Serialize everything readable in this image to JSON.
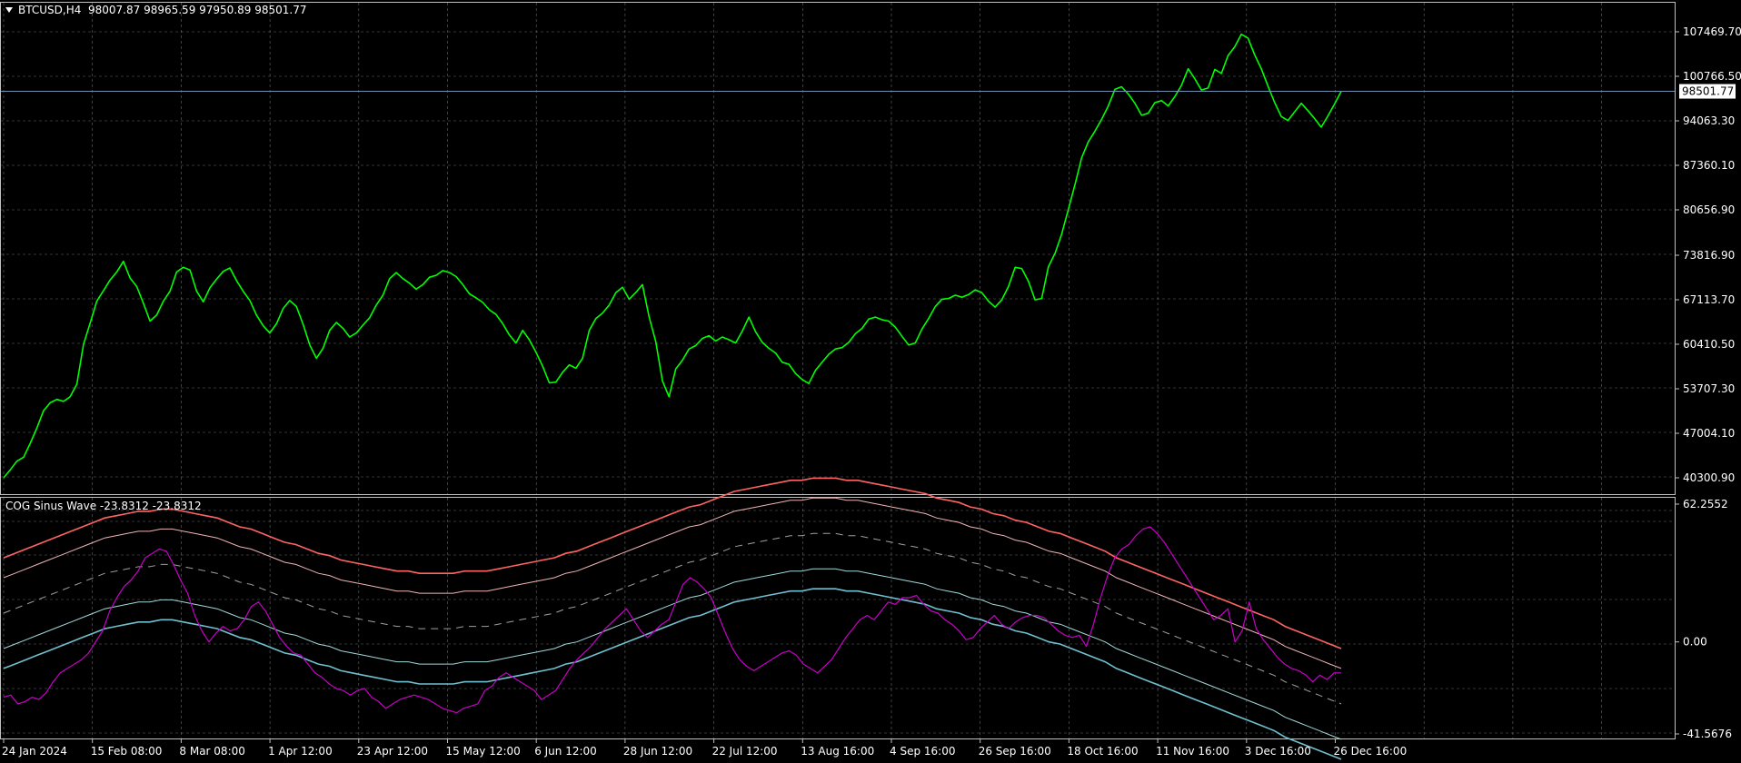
{
  "header": {
    "symbol": "BTCUSD,H4",
    "ohlc": "98007.87 98965.59 97950.89 98501.77"
  },
  "indicator": {
    "title": "COG Sinus Wave -23.8312 -23.8312"
  },
  "colors": {
    "background": "#000000",
    "grid": "#c0c0c0",
    "price": "#00ff00",
    "indicator_line": "#c800c8",
    "band_upper": "#ff6464",
    "band_upper_inner": "#f0b4b4",
    "band_mid": "#a0a0a0",
    "band_lower_inner": "#a0d8d8",
    "band_lower": "#70c0d0",
    "current_price_line": "#7090b0"
  },
  "price_axis": {
    "ticks": [
      "107469.70",
      "100766.50",
      "94063.30",
      "87360.10",
      "80656.90",
      "73816.90",
      "67113.70",
      "60410.50",
      "53707.30",
      "47004.10",
      "40300.90"
    ],
    "tick_values": [
      107469.7,
      100766.5,
      94063.3,
      87360.1,
      80656.9,
      73816.9,
      67113.7,
      60410.5,
      53707.3,
      47004.1,
      40300.9
    ],
    "current_label": "98501.77",
    "current_value": 98501.77
  },
  "indicator_axis": {
    "ticks": [
      "62.2552",
      "0.00",
      "-41.5676"
    ],
    "tick_values": [
      62.2552,
      0.0,
      -41.5676
    ]
  },
  "time_axis": {
    "labels": [
      "24 Jan 2024",
      "15 Feb 08:00",
      "8 Mar 08:00",
      "1 Apr 12:00",
      "23 Apr 12:00",
      "15 May 12:00",
      "6 Jun 12:00",
      "28 Jun 12:00",
      "22 Jul 12:00",
      "13 Aug 16:00",
      "4 Sep 16:00",
      "26 Sep 16:00",
      "18 Oct 16:00",
      "11 Nov 16:00",
      "3 Dec 16:00",
      "26 Dec 16:00"
    ]
  },
  "chart_data": [
    {
      "type": "line",
      "series": [
        {
          "values": [
            40300,
            41500,
            42800,
            43400,
            45500,
            47800,
            50400,
            51600,
            52100,
            51800,
            52500,
            54400,
            60400,
            63600,
            66900,
            68500,
            70100,
            71300,
            72900,
            70400,
            69100,
            66600,
            63900,
            64800,
            66900,
            68400,
            71300,
            72000,
            71600,
            68400,
            66800,
            68900,
            70200,
            71400,
            71900,
            70000,
            68400,
            67000,
            64800,
            63200,
            62100,
            63500,
            65800,
            67000,
            66100,
            63400,
            60300,
            58300,
            59800,
            62500,
            63700,
            62800,
            61500,
            62100,
            63300,
            64400,
            66300,
            67800,
            70300,
            71200,
            70300,
            69600,
            68700,
            69400,
            70500,
            70800,
            71500,
            71200,
            70600,
            69400,
            68000,
            67400,
            66700,
            65600,
            64900,
            63500,
            61800,
            60600,
            62500,
            61100,
            59200,
            57100,
            54600,
            54700,
            56200,
            57300,
            56800,
            58300,
            62500,
            64300,
            65100,
            66300,
            68200,
            69000,
            67200,
            68200,
            69400,
            64500,
            60800,
            54900,
            52500,
            56700,
            58000,
            59700,
            60200,
            61300,
            61700,
            60900,
            61500,
            61100,
            60600,
            62400,
            64500,
            62300,
            60700,
            59800,
            59100,
            57700,
            57400,
            56000,
            55100,
            54500,
            56500,
            57700,
            58900,
            59700,
            59900,
            60700,
            62000,
            62800,
            64200,
            64500,
            64100,
            63900,
            63000,
            61600,
            60300,
            60600,
            62700,
            64300,
            66100,
            67200,
            67300,
            67800,
            67500,
            67900,
            68600,
            68200,
            66900,
            66000,
            67100,
            69100,
            72000,
            71800,
            69900,
            67100,
            67300,
            72100,
            74100,
            77000,
            80700,
            84500,
            88500,
            90900,
            92500,
            94300,
            96300,
            98800,
            99200,
            98100,
            96700,
            94900,
            95200,
            96800,
            97100,
            96300,
            97700,
            99400,
            101900,
            100400,
            98700,
            99000,
            101800,
            101200,
            103900,
            105200,
            107100,
            106500,
            104000,
            101900,
            99300,
            96800,
            94700,
            94100,
            95400,
            96700,
            95600,
            94400,
            93100,
            94800,
            96600,
            98500
          ]
        }
      ]
    },
    {
      "type": "line",
      "series": [
        {
          "values": [
            -25,
            -24,
            -28,
            -27,
            -25,
            -26,
            -23,
            -18,
            -14,
            -12,
            -10,
            -8,
            -5,
            0,
            5,
            14,
            20,
            25,
            28,
            32,
            38,
            40,
            42,
            41,
            35,
            28,
            22,
            12,
            5,
            0,
            4,
            7,
            5,
            6,
            10,
            16,
            18,
            14,
            8,
            2,
            -2,
            -5,
            -6,
            -10,
            -14,
            -16,
            -19,
            -21,
            -22,
            -24,
            -22,
            -21,
            -25,
            -27,
            -30,
            -28,
            -26,
            -25,
            -24,
            -25,
            -26,
            -28,
            -30,
            -31,
            -32,
            -30,
            -29,
            -28,
            -22,
            -20,
            -16,
            -14,
            -16,
            -18,
            -20,
            -22,
            -26,
            -24,
            -22,
            -17,
            -12,
            -8,
            -5,
            -2,
            2,
            6,
            9,
            12,
            15,
            10,
            5,
            2,
            5,
            8,
            10,
            18,
            26,
            29,
            27,
            24,
            20,
            12,
            4,
            -3,
            -8,
            -11,
            -13,
            -11,
            -9,
            -7,
            -5,
            -4,
            -6,
            -10,
            -12,
            -14,
            -11,
            -8,
            -3,
            2,
            6,
            10,
            12,
            10,
            14,
            18,
            17,
            20,
            20,
            21,
            17,
            14,
            13,
            10,
            8,
            5,
            1,
            2,
            6,
            9,
            12,
            8,
            6,
            9,
            11,
            12,
            12,
            11,
            8,
            5,
            3,
            2,
            3,
            -2,
            8,
            20,
            30,
            38,
            42,
            44,
            48,
            51,
            52,
            49,
            45,
            40,
            35,
            30,
            25,
            20,
            15,
            10,
            12,
            15,
            0,
            5,
            18,
            6,
            1,
            -3,
            -7,
            -10,
            -12,
            -13,
            -15,
            -18,
            -15,
            -17,
            -14,
            -14
          ]
        },
        {
          "values": [
            13,
            15,
            17,
            19,
            21,
            23,
            25,
            27,
            29,
            31,
            32,
            33,
            34,
            34,
            35,
            35,
            34,
            33,
            32,
            31,
            29,
            27,
            26,
            24,
            22,
            20,
            19,
            17,
            15,
            14,
            12,
            11,
            10,
            9,
            8,
            7,
            7,
            6,
            6,
            6,
            6,
            7,
            7,
            7,
            8,
            9,
            10,
            11,
            12,
            13,
            15,
            16,
            18,
            20,
            22,
            24,
            26,
            28,
            30,
            32,
            34,
            36,
            37,
            39,
            41,
            43,
            44,
            45,
            46,
            47,
            48,
            48,
            49,
            49,
            49,
            48,
            48,
            47,
            46,
            45,
            44,
            43,
            42,
            40,
            39,
            38,
            36,
            35,
            33,
            32,
            30,
            29,
            27,
            25,
            24,
            22,
            20,
            18,
            16,
            13,
            11,
            9,
            7,
            5,
            3,
            1,
            -1,
            -3,
            -5,
            -7,
            -9,
            -11,
            -13,
            -15,
            -18,
            -20,
            -22,
            -24,
            -26,
            -28
          ]
        }
      ]
    }
  ]
}
